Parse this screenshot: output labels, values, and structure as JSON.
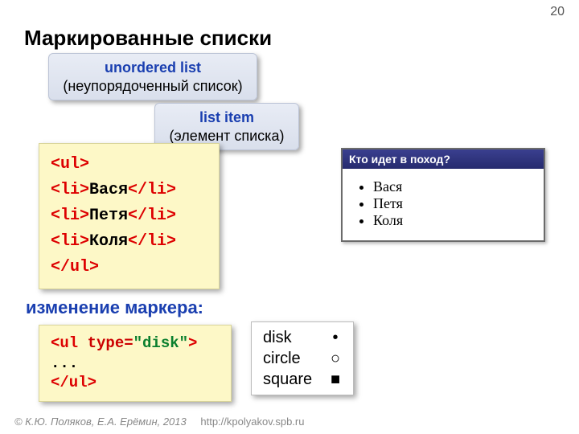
{
  "page_number": "20",
  "title": "Маркированные списки",
  "callout_ul": {
    "term": "unordered list",
    "sub": "(неупорядоченный список)"
  },
  "callout_li": {
    "term": "list item",
    "sub": "(элемент списка)"
  },
  "code1": {
    "l1a": "<ul>",
    "l2a": "<li>",
    "l2b": "Вася",
    "l2c": "</li>",
    "l3a": "<li>",
    "l3b": "Петя",
    "l3c": "</li>",
    "l4a": "<li>",
    "l4b": "Коля",
    "l4c": "</li>",
    "l5a": "</ul>"
  },
  "sub_title": "изменение маркера:",
  "code2": {
    "l1a": "<ul ",
    "l1b": "type=",
    "l1c": "\"disk\"",
    "l1d": ">",
    "l2": "...",
    "l3": "</ul>"
  },
  "markers": [
    {
      "label": "disk",
      "sym": "•"
    },
    {
      "label": "circle",
      "sym": "○"
    },
    {
      "label": "square",
      "sym": "■"
    }
  ],
  "preview": {
    "title": "Кто идет в поход?",
    "items": [
      "Вася",
      "Петя",
      "Коля"
    ]
  },
  "footer": {
    "authors": "© К.Ю. Поляков, Е.А. Ерёмин, 2013",
    "url": "http://kpolyakov.spb.ru"
  }
}
